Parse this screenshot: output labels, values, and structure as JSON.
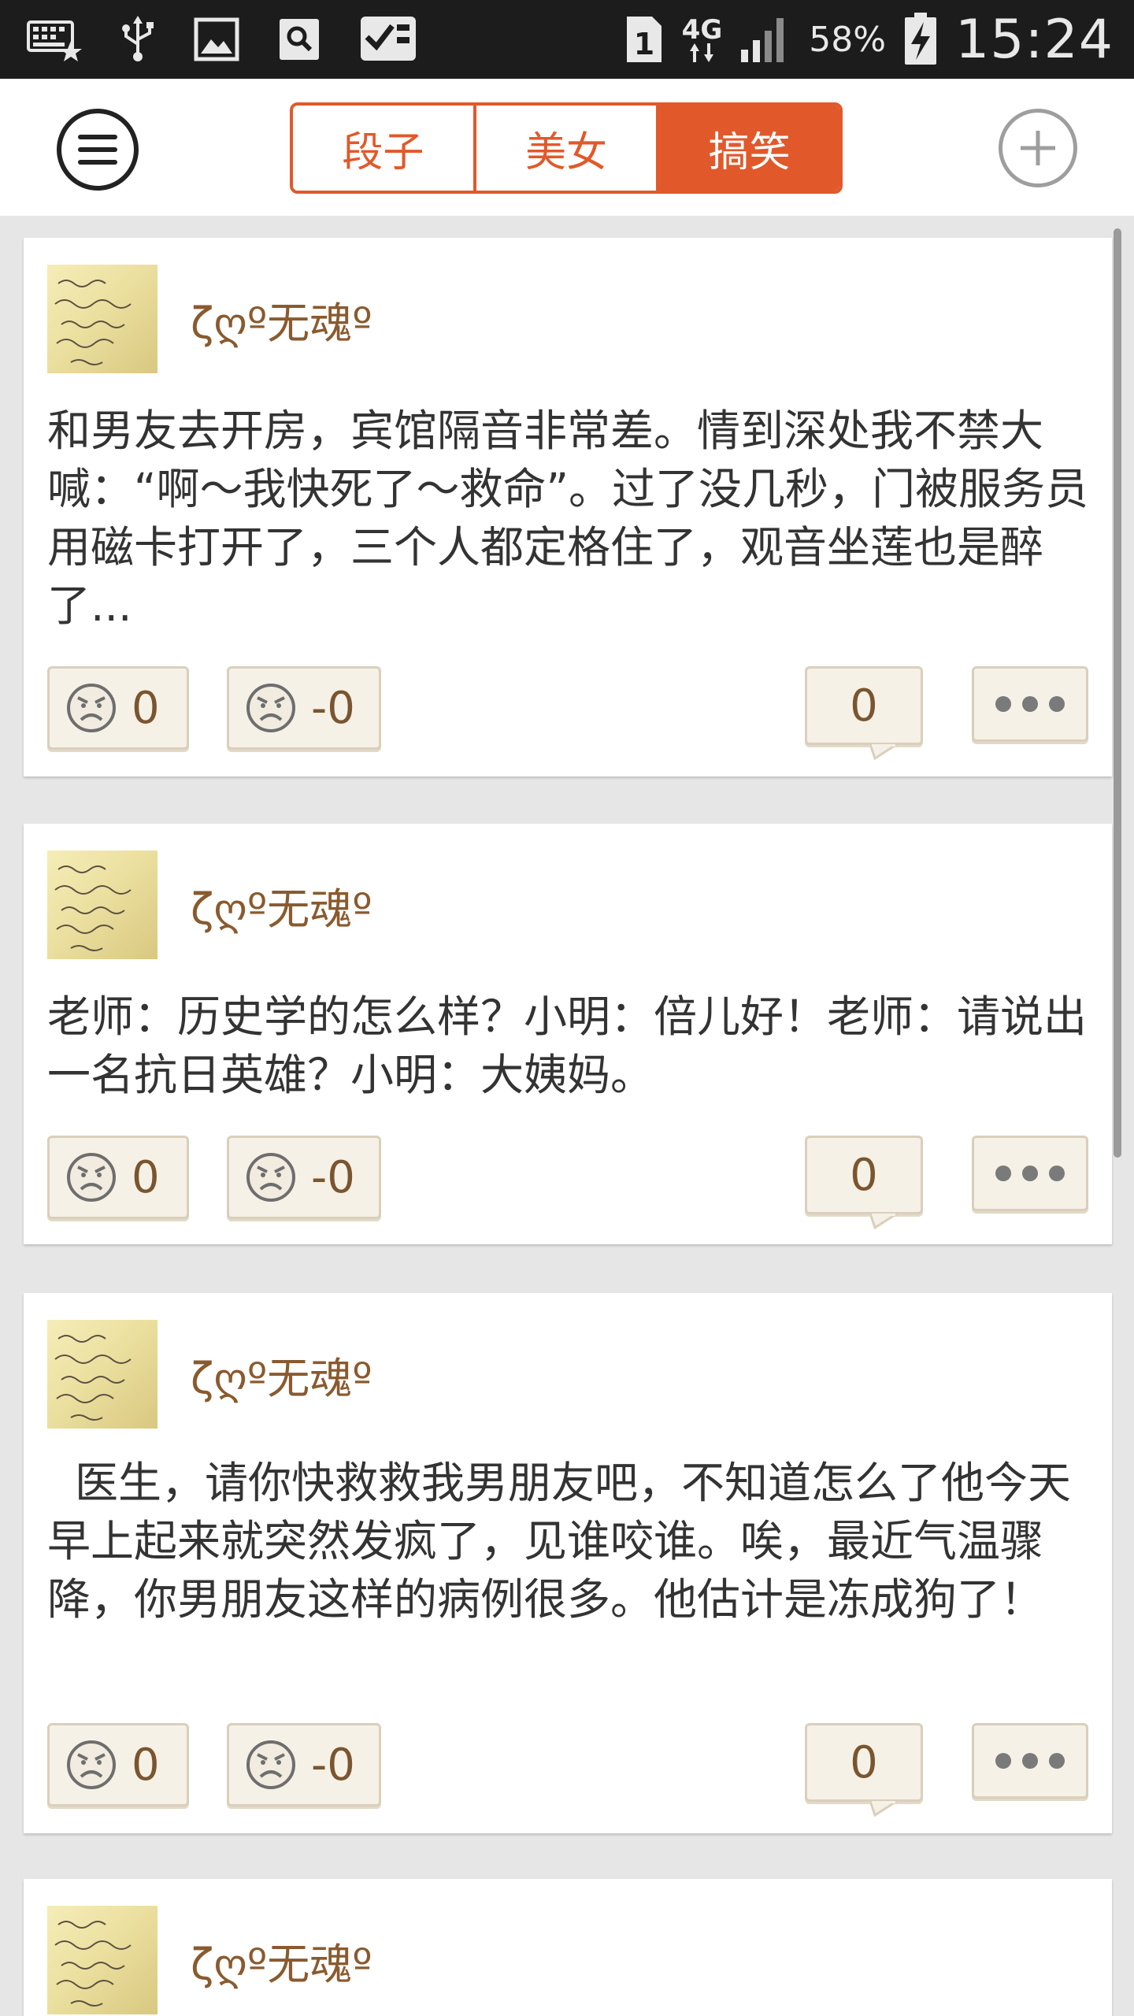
{
  "status_bar": {
    "sim_indicator": "1",
    "network_type": "4G",
    "battery_percent": "58%",
    "time": "15:24"
  },
  "header": {
    "tabs": [
      {
        "label": "段子",
        "active": false
      },
      {
        "label": "美女",
        "active": false
      },
      {
        "label": "搞笑",
        "active": true
      }
    ],
    "accent_color": "#e1592a"
  },
  "posts": [
    {
      "username": "ζღº无魂º",
      "text": "和男友去开房，宾馆隔音非常差。情到深处我不禁大喊：“啊～我快死了～救命”。过了没几秒，门被服务员用磁卡打开了，三个人都定格住了，观音坐莲也是醉了...",
      "likes": "0",
      "dislikes": "-0",
      "comments": "0"
    },
    {
      "username": "ζღº无魂º",
      "text": "老师：历史学的怎么样？小明：倍儿好！老师：请说出一名抗日英雄？小明：大姨妈。",
      "likes": "0",
      "dislikes": "-0",
      "comments": "0"
    },
    {
      "username": "ζღº无魂º",
      "text": "  医生，请你快救救我男朋友吧，不知道怎么了他今天早上起来就突然发疯了，见谁咬谁。唉，最近气温骤降，你男朋友这样的病例很多。他估计是冻成狗了！",
      "likes": "0",
      "dislikes": "-0",
      "comments": "0"
    },
    {
      "username": "ζღº无魂º"
    }
  ]
}
